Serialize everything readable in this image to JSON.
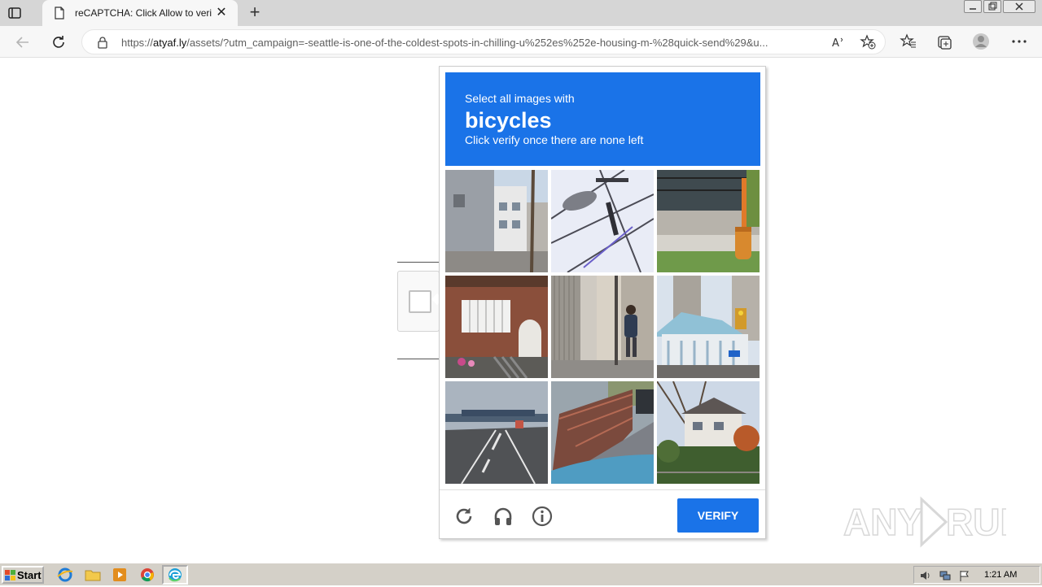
{
  "browser": {
    "tab": {
      "title": "reCAPTCHA: Click Allow to verify",
      "icon": "page-icon"
    },
    "address": {
      "url_prefix": "https://",
      "url_domain": "atyaf.ly",
      "url_rest": "/assets/?utm_campaign=-seattle-is-one-of-the-coldest-spots-in-chilling-u%252es%252e-housing-m-%28quick-send%29&u..."
    }
  },
  "captcha": {
    "instruction": "Select all images with",
    "target": "bicycles",
    "sub_instruction": "Click verify once there are none left",
    "tiles": [
      {
        "index": 1,
        "scene": "narrow-street-buildings"
      },
      {
        "index": 2,
        "scene": "street-lamp-wires"
      },
      {
        "index": 3,
        "scene": "fire-hydrant-fence"
      },
      {
        "index": 4,
        "scene": "brick-house-windows"
      },
      {
        "index": 5,
        "scene": "man-walking-sidewalk"
      },
      {
        "index": 6,
        "scene": "traffic-light-buildings"
      },
      {
        "index": 7,
        "scene": "highway-overpass"
      },
      {
        "index": 8,
        "scene": "bridge-railing-car"
      },
      {
        "index": 9,
        "scene": "house-trees"
      }
    ],
    "verify_label": "VERIFY"
  },
  "watermark": {
    "text": "ANY RUN"
  },
  "taskbar": {
    "start_label": "Start",
    "clock": "1:21 AM"
  },
  "colors": {
    "captcha_blue": "#1a73e8",
    "taskbar": "#d4d0c8"
  }
}
